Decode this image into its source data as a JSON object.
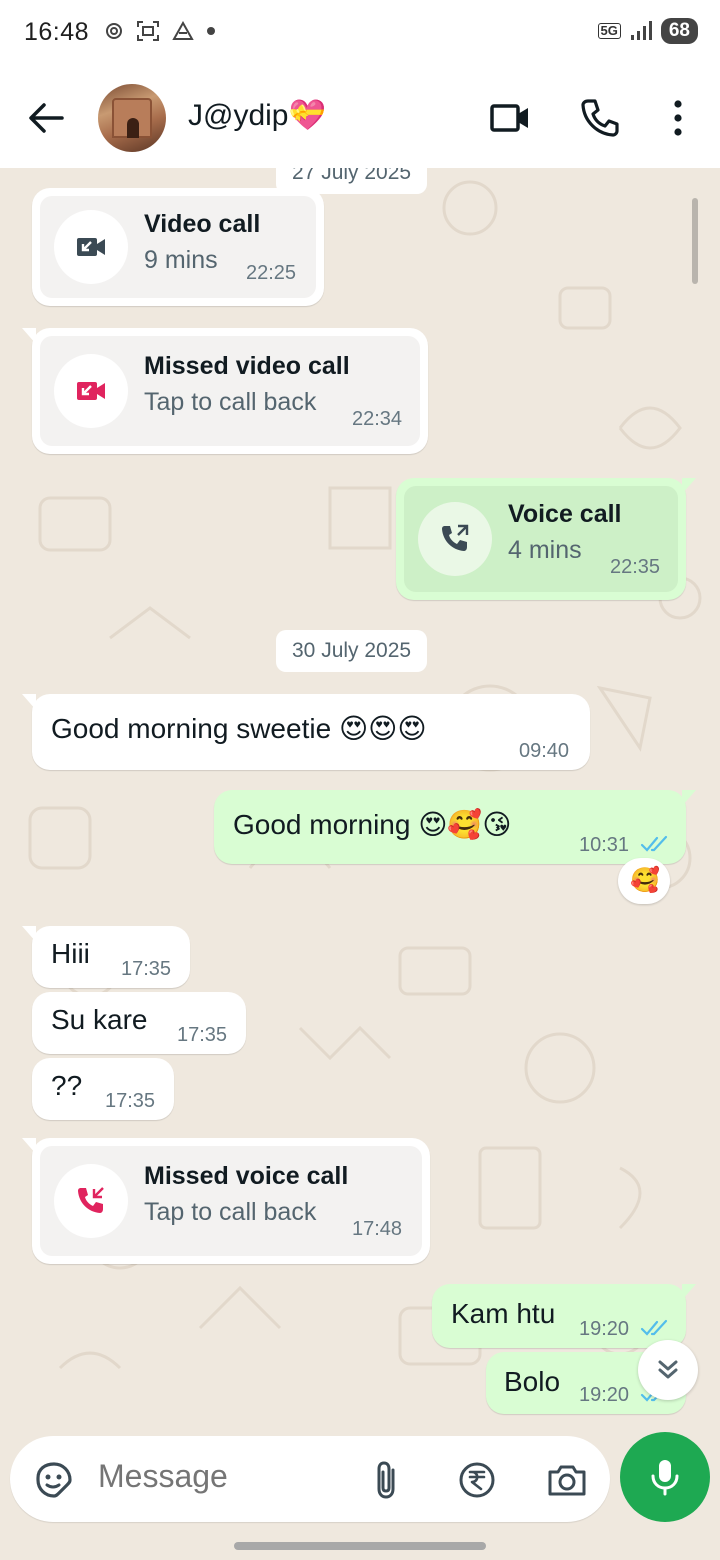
{
  "status_bar": {
    "time": "16:48",
    "network": "5G",
    "battery": "68",
    "icons": [
      "nfc-icon",
      "screen-capture-icon",
      "drive-icon",
      "dot-icon",
      "signal-icon"
    ]
  },
  "header": {
    "contact_name": "J@ydip💝",
    "icons": [
      "back-arrow-icon",
      "video-call-icon",
      "phone-icon",
      "more-vert-icon"
    ]
  },
  "chat": {
    "top_date_partial": "27 July 2025",
    "messages": [
      {
        "type": "call",
        "direction": "in",
        "title": "Video call",
        "subtitle": "9 mins",
        "time": "22:25",
        "icon": "video-incoming-icon"
      },
      {
        "type": "call",
        "direction": "in",
        "title": "Missed video call",
        "subtitle": "Tap to call back",
        "time": "22:34",
        "icon": "video-missed-icon"
      },
      {
        "type": "call",
        "direction": "out",
        "title": "Voice call",
        "subtitle": "4 mins",
        "time": "22:35",
        "icon": "phone-outgoing-icon"
      },
      {
        "type": "date",
        "label": "30 July 2025"
      },
      {
        "type": "text",
        "direction": "in",
        "text": "Good morning sweetie",
        "emoji": [
          "😍",
          "😍",
          "😍"
        ],
        "time": "09:40"
      },
      {
        "type": "text",
        "direction": "out",
        "text": "Good morning",
        "emoji": [
          "😍",
          "🥰",
          "😘"
        ],
        "time": "10:31",
        "status": "read",
        "reaction": "🥰"
      },
      {
        "type": "text",
        "direction": "in",
        "text": "Hiii",
        "time": "17:35"
      },
      {
        "type": "text",
        "direction": "in",
        "text": "Su kare",
        "time": "17:35"
      },
      {
        "type": "text",
        "direction": "in",
        "text": "??",
        "time": "17:35"
      },
      {
        "type": "call",
        "direction": "in",
        "title": "Missed voice call",
        "subtitle": "Tap to call back",
        "time": "17:48",
        "icon": "phone-missed-icon"
      },
      {
        "type": "text",
        "direction": "out",
        "text": "Kam htu",
        "time": "19:20",
        "status": "read"
      },
      {
        "type": "text",
        "direction": "out",
        "text": "Bolo",
        "time": "19:20",
        "status": "read"
      }
    ]
  },
  "composer": {
    "placeholder": "Message",
    "icons": [
      "sticker-icon",
      "attach-icon",
      "rupee-icon",
      "camera-icon",
      "mic-icon"
    ]
  },
  "colors": {
    "incoming_bubble": "#ffffff",
    "outgoing_bubble": "#d9fdd3",
    "chat_background": "#efe8de",
    "accent_green": "#1ea952",
    "read_ticks": "#53bdeb",
    "missed_call_red": "#e0245e"
  }
}
